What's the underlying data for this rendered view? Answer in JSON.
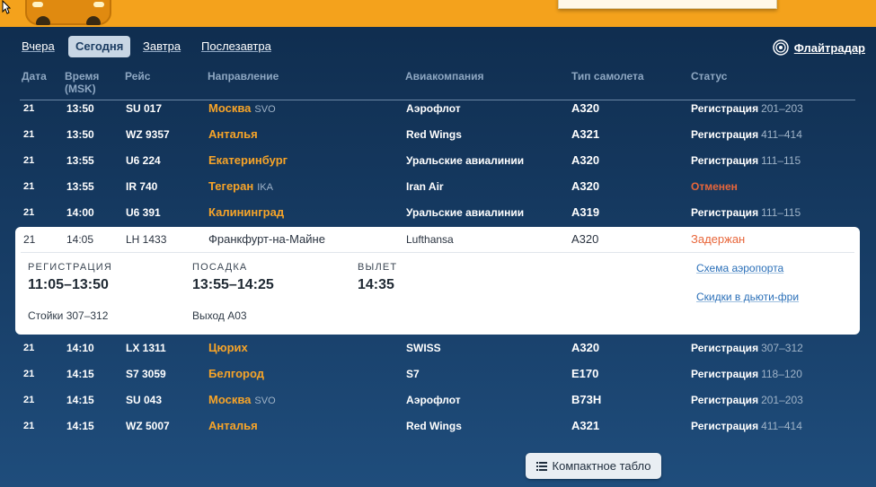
{
  "nav": {
    "days": [
      "Вчера",
      "Сегодня",
      "Завтра",
      "Послезавтра"
    ],
    "active_day": "Сегодня",
    "flightradar_label": "Флайтрадар"
  },
  "table": {
    "headers": {
      "date": "Дата",
      "time_line1": "Время",
      "time_line2": "(MSK)",
      "flight": "Рейс",
      "destination": "Направление",
      "airline": "Авиакомпания",
      "aircraft": "Тип самолета",
      "status": "Статус"
    },
    "rows": [
      {
        "date": "21",
        "time": "13:50",
        "flight": "SU 017",
        "dest": "Москва",
        "code": "SVO",
        "airline": "Аэрофлот",
        "aircraft": "A320",
        "status": "Регистрация",
        "gate": "201–203"
      },
      {
        "date": "21",
        "time": "13:50",
        "flight": "WZ 9357",
        "dest": "Анталья",
        "code": "",
        "airline": "Red Wings",
        "aircraft": "A321",
        "status": "Регистрация",
        "gate": "411–414"
      },
      {
        "date": "21",
        "time": "13:55",
        "flight": "U6 224",
        "dest": "Екатеринбург",
        "code": "",
        "airline": "Уральские авиалинии",
        "aircraft": "A320",
        "status": "Регистрация",
        "gate": "111–115"
      },
      {
        "date": "21",
        "time": "13:55",
        "flight": "IR 740",
        "dest": "Тегеран",
        "code": "IKA",
        "airline": "Iran Air",
        "aircraft": "A320",
        "status": "Отменен",
        "gate": ""
      },
      {
        "date": "21",
        "time": "14:00",
        "flight": "U6 391",
        "dest": "Калининград",
        "code": "",
        "airline": "Уральские авиалинии",
        "aircraft": "A319",
        "status": "Регистрация",
        "gate": "111–115"
      }
    ],
    "expanded": {
      "date": "21",
      "time": "14:05",
      "flight": "LH 1433",
      "dest": "Франкфурт-на-Майне",
      "airline": "Lufthansa",
      "aircraft": "A320",
      "status": "Задержан",
      "registration_caption": "РЕГИСТРАЦИЯ",
      "registration_time": "11:05–13:50",
      "registration_counters": "Стойки 307–312",
      "boarding_caption": "ПОСАДКА",
      "boarding_time": "13:55–14:25",
      "boarding_gate": "Выход A03",
      "departure_caption": "ВЫЛЕТ",
      "departure_time": "14:35",
      "link_airport_map": "Схема аэропорта",
      "link_duty_free": "Скидки в дьюти-фри"
    },
    "rows_after": [
      {
        "date": "21",
        "time": "14:10",
        "flight": "LX 1311",
        "dest": "Цюрих",
        "code": "",
        "airline": "SWISS",
        "aircraft": "A320",
        "status": "Регистрация",
        "gate": "307–312"
      },
      {
        "date": "21",
        "time": "14:15",
        "flight": "S7 3059",
        "dest": "Белгород",
        "code": "",
        "airline": "S7",
        "aircraft": "E170",
        "status": "Регистрация",
        "gate": "118–120"
      },
      {
        "date": "21",
        "time": "14:15",
        "flight": "SU 043",
        "dest": "Москва",
        "code": "SVO",
        "airline": "Аэрофлот",
        "aircraft": "B73H",
        "status": "Регистрация",
        "gate": "201–203"
      },
      {
        "date": "21",
        "time": "14:15",
        "flight": "WZ 5007",
        "dest": "Анталья",
        "code": "",
        "airline": "Red Wings",
        "aircraft": "A321",
        "status": "Регистрация",
        "gate": "411–414"
      }
    ]
  },
  "footer": {
    "compact_label": "Компактное табло"
  },
  "colors": {
    "accent_orange": "#f7a428",
    "cancel_red": "#e8663a",
    "top_bar": "#f4a21c"
  }
}
